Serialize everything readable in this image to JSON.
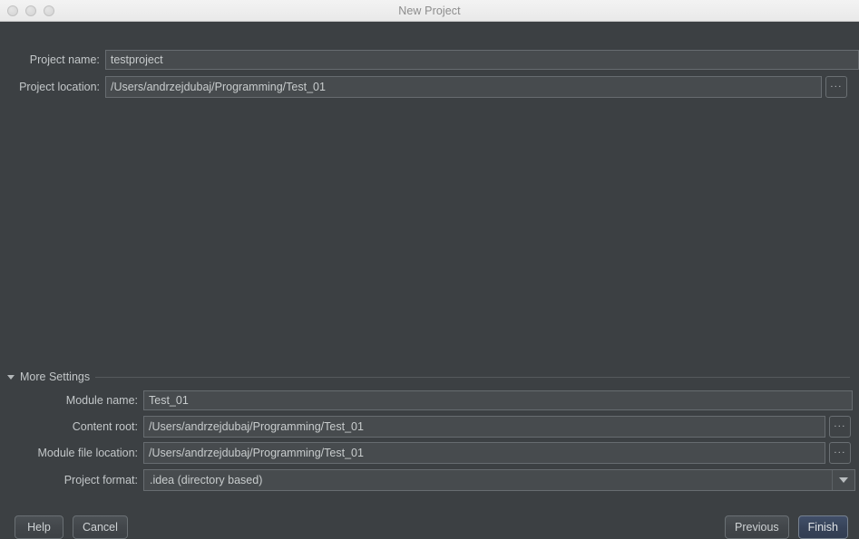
{
  "window": {
    "title": "New Project",
    "traffic_lights": [
      "close-button",
      "minimize-button",
      "zoom-button"
    ]
  },
  "top_form": {
    "project_name": {
      "label": "Project name:",
      "value": "testproject",
      "placeholder": ""
    },
    "project_location": {
      "label": "Project location:",
      "value": "/Users/andrzejdubaj/Programming/Test_01",
      "placeholder": "",
      "browse_label": "..."
    }
  },
  "more_settings": {
    "label": "More Settings",
    "expanded": true,
    "module_name": {
      "label": "Module name:",
      "value": "Test_01",
      "placeholder": ""
    },
    "content_root": {
      "label": "Content root:",
      "value": "/Users/andrzejdubaj/Programming/Test_01",
      "placeholder": "",
      "browse_label": "..."
    },
    "module_file_location": {
      "label": "Module file location:",
      "value": "/Users/andrzejdubaj/Programming/Test_01",
      "placeholder": "",
      "browse_label": "..."
    },
    "project_format": {
      "label": "Project format:",
      "value": ".idea (directory based)",
      "options": [
        ".idea (directory based)"
      ]
    }
  },
  "footer": {
    "help_label": "Help",
    "cancel_label": "Cancel",
    "previous_label": "Previous",
    "finish_label": "Finish"
  },
  "colors": {
    "window_background": "#3c4043",
    "titlebar_background": "#f0f0f0",
    "field_background": "#474b4e",
    "field_border": "#676c70",
    "text": "#c3c7c9",
    "primary_button": "#3a465d"
  }
}
